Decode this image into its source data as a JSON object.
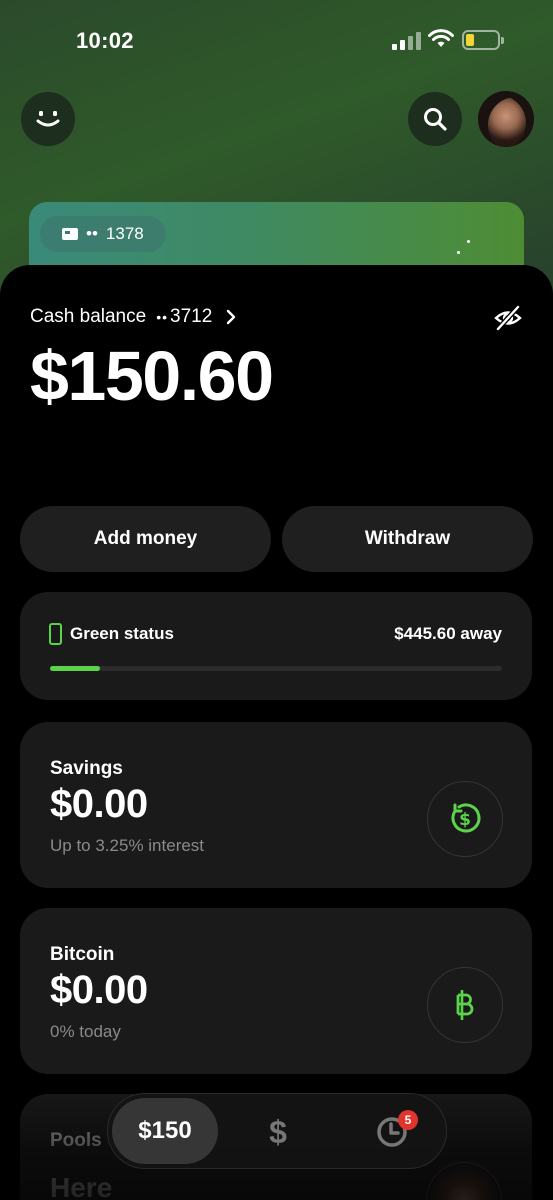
{
  "status_bar": {
    "time": "10:02"
  },
  "card": {
    "last4": "1378",
    "dots": "••"
  },
  "cash": {
    "label": "Cash balance",
    "dots": "••",
    "account_last4": "3712",
    "balance": "$150.60"
  },
  "actions": {
    "add_money": "Add money",
    "withdraw": "Withdraw"
  },
  "green_status": {
    "label": "Green status",
    "away": "$445.60 away",
    "progress": 0.11,
    "color": "#5bd44a"
  },
  "savings": {
    "name": "Savings",
    "amount": "$0.00",
    "sub": "Up to 3.25% interest",
    "icon": "dollar-circle-icon"
  },
  "bitcoin": {
    "name": "Bitcoin",
    "amount": "$0.00",
    "sub": "0% today",
    "icon": "bitcoin-icon"
  },
  "pools": {
    "name": "Pools",
    "sub": "Here"
  },
  "tabbar": {
    "amount": "$150",
    "dollar_symbol": "$",
    "activity_badge": "5"
  },
  "colors": {
    "accent": "#5bd44a",
    "panel": "#1a1a1a",
    "badge": "#e0342c"
  }
}
